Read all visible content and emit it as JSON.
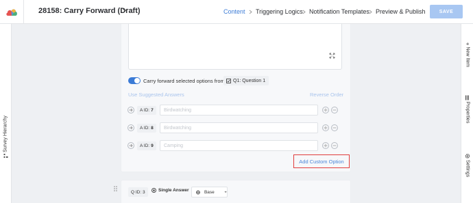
{
  "header": {
    "title": "28158: Carry Forward (Draft)",
    "tabs": [
      {
        "label": "Content",
        "active": true
      },
      {
        "label": "Triggering Logics",
        "active": false
      },
      {
        "label": "Notification Templates",
        "active": false
      },
      {
        "label": "Preview & Publish",
        "active": false
      }
    ],
    "save_label": "SAVE"
  },
  "left_sidebar": {
    "label": "Survey Hierarchy"
  },
  "right_sidebar": {
    "items": [
      {
        "label": "New Item",
        "icon": "plus-icon"
      },
      {
        "label": "Properties",
        "icon": "sliders-icon"
      },
      {
        "label": "Settings",
        "icon": "gear-icon"
      }
    ]
  },
  "carry_forward": {
    "enabled": true,
    "label": "Carry forward selected options from",
    "source_question": "Q1: Question 1",
    "suggested_label": "Use Suggested Answers",
    "reverse_label": "Reverse Order"
  },
  "answers": [
    {
      "aid_label": "A ID:",
      "aid": "7",
      "text": "Birdwatching"
    },
    {
      "aid_label": "A ID:",
      "aid": "8",
      "text": "Birdwatching"
    },
    {
      "aid_label": "A ID:",
      "aid": "9",
      "text": "Camping"
    }
  ],
  "add_custom_option_label": "Add Custom Option",
  "next_question": {
    "qid_label": "Q ID:",
    "qid": "3",
    "type": "Single Answer",
    "language": "Base"
  },
  "colors": {
    "accent": "#3b7bd6",
    "save_disabled": "#a8c7f2",
    "highlight_border": "#e03b3b"
  }
}
